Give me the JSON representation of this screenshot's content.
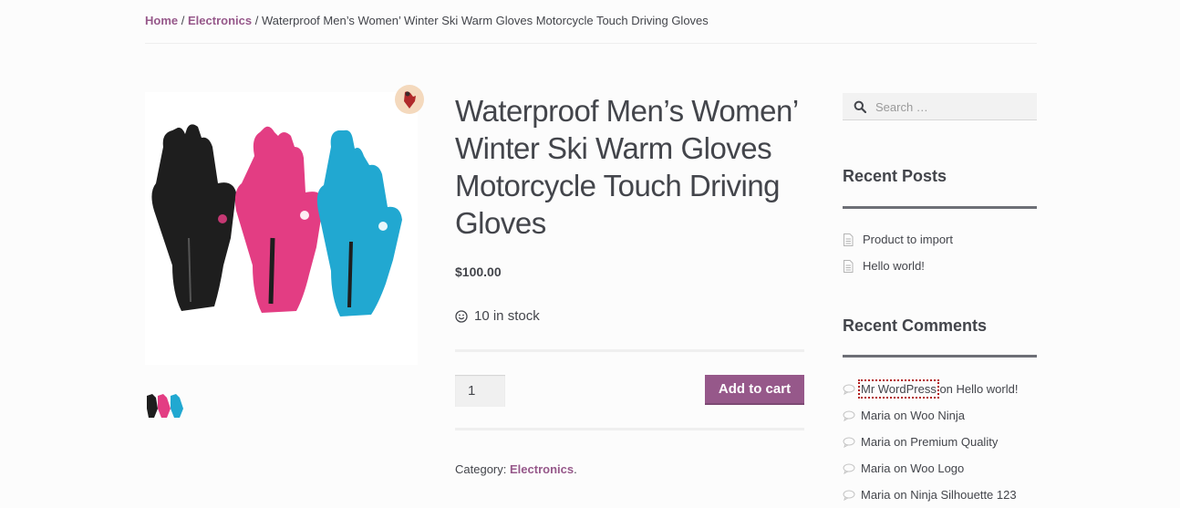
{
  "breadcrumb": {
    "home": "Home",
    "sep1": "/",
    "category": "Electronics",
    "sep2": "/",
    "current": "Waterproof Men’s Women’ Winter Ski Warm Gloves Motorcycle Touch Driving Gloves"
  },
  "product": {
    "title": "Waterproof Men’s Women’ Winter Ski Warm Gloves Motorcycle Touch Driving Gloves",
    "price": "$100.00",
    "stock": "10 in stock",
    "quantity": "1",
    "add_to_cart": "Add to cart",
    "category_label": "Category:",
    "category": "Electronics",
    "category_suffix": ".",
    "image_alt": "Black, pink and blue gloves"
  },
  "sidebar": {
    "search_placeholder": "Search …",
    "recent_posts_title": "Recent Posts",
    "recent_posts": [
      {
        "label": "Product to import"
      },
      {
        "label": "Hello world!"
      }
    ],
    "recent_comments_title": "Recent Comments",
    "recent_comments": [
      {
        "author": "Mr WordPress",
        "on": "on",
        "post": "Hello world!"
      },
      {
        "author": "Maria",
        "on": "on",
        "post": "Woo Ninja"
      },
      {
        "author": "Maria",
        "on": "on",
        "post": "Premium Quality"
      },
      {
        "author": "Maria",
        "on": "on",
        "post": "Woo Logo"
      },
      {
        "author": "Maria",
        "on": "on",
        "post": "Ninja Silhouette 123"
      }
    ]
  },
  "colors": {
    "accent": "#96588a",
    "text": "#43454b",
    "background": "#fcfcfc",
    "glove_black": "#1e1e1e",
    "glove_pink": "#e33d83",
    "glove_blue": "#21a8d1"
  }
}
